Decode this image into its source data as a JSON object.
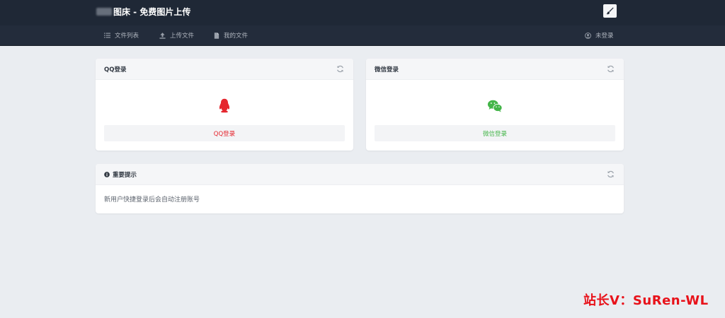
{
  "header": {
    "title": "图床 - 免费图片上传",
    "theme_icon": "brush-icon"
  },
  "nav": {
    "items": [
      {
        "label": "文件列表",
        "icon": "list-icon"
      },
      {
        "label": "上传文件",
        "icon": "upload-icon"
      },
      {
        "label": "我的文件",
        "icon": "file-icon"
      }
    ],
    "user": {
      "label": "未登录",
      "icon": "user-icon"
    }
  },
  "qq_panel": {
    "title": "QQ登录",
    "button_label": "QQ登录",
    "color": "#e5262e",
    "icon": "qq-penguin-icon"
  },
  "wechat_panel": {
    "title": "微信登录",
    "button_label": "微信登录",
    "color": "#44b549",
    "icon": "wechat-icon"
  },
  "notice_panel": {
    "title": "重要提示",
    "text": "新用户快捷登录后会自动注册账号"
  },
  "watermark": {
    "text": "站长V：SuRen-WL",
    "color": "#e8121a"
  }
}
